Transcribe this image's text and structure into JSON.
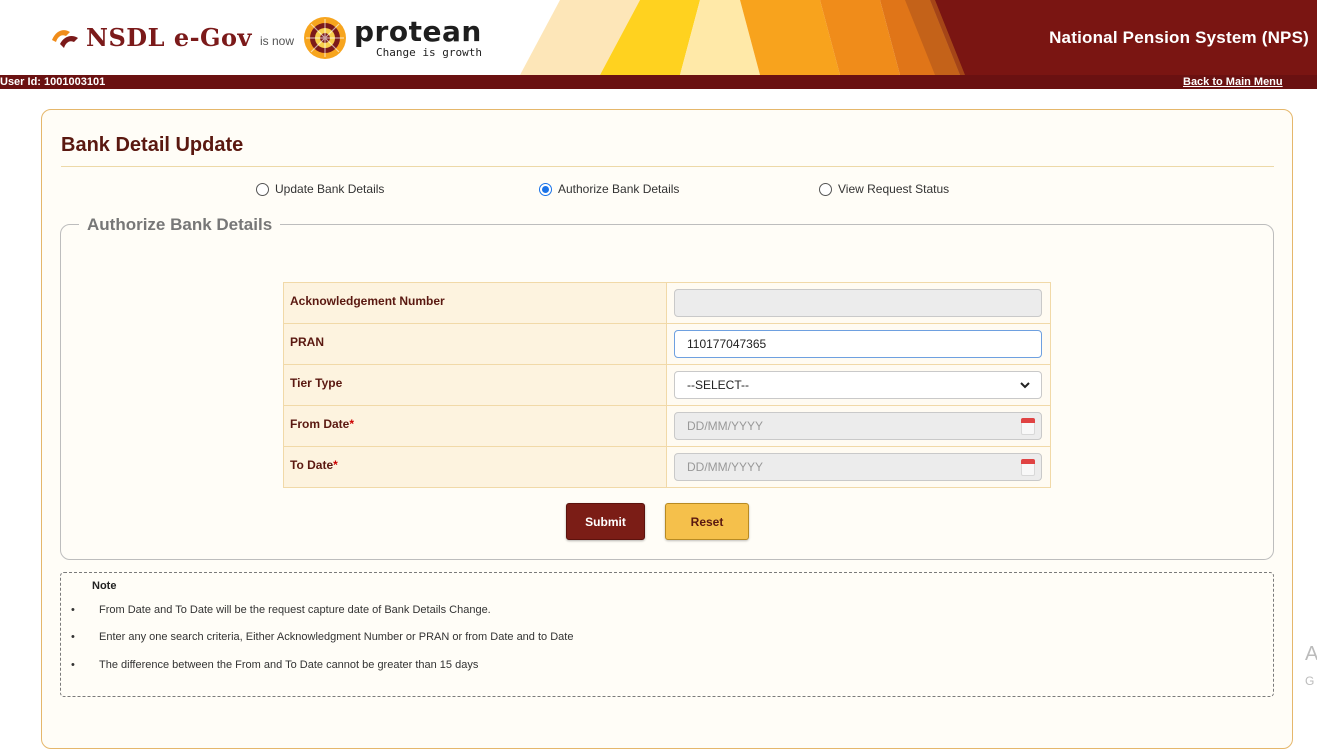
{
  "header": {
    "nsdl_brand": "NSDL e-Gov",
    "is_now": "is now",
    "protean_brand": "protean",
    "protean_tagline": "Change is growth",
    "system_title": "National Pension System (NPS)",
    "user_id": "User Id: 1001003101",
    "back_link": "Back to Main Menu"
  },
  "page": {
    "title": "Bank Detail Update"
  },
  "radios": [
    {
      "label": "Update Bank Details",
      "checked": false
    },
    {
      "label": "Authorize Bank Details",
      "checked": true
    },
    {
      "label": "View Request Status",
      "checked": false
    }
  ],
  "section": {
    "legend": "Authorize Bank Details"
  },
  "form": {
    "ack_label": "Acknowledgement Number",
    "ack_value": "",
    "pran_label": "PRAN",
    "pran_value": "110177047365",
    "tier_label": "Tier Type",
    "tier_value": "--SELECT--",
    "from_label": "From Date",
    "from_placeholder": "DD/MM/YYYY",
    "to_label": "To Date",
    "to_placeholder": "DD/MM/YYYY",
    "required_mark": "*"
  },
  "buttons": {
    "submit": "Submit",
    "reset": "Reset"
  },
  "note": {
    "title": "Note",
    "items": [
      "From Date and To Date will be the request capture date of Bank Details Change.",
      "Enter any one search criteria, Either Acknowledgment Number or PRAN or from Date and to Date",
      "The difference between the From and To Date cannot be greater than 15 days"
    ],
    "bullet": "•"
  },
  "edge_fragment": {
    "big": "A",
    "small": "G"
  },
  "colors": {
    "brand_maroon": "#7b1d16",
    "accent_yellow": "#f5c04b",
    "header_orange": "#f08c1a"
  }
}
